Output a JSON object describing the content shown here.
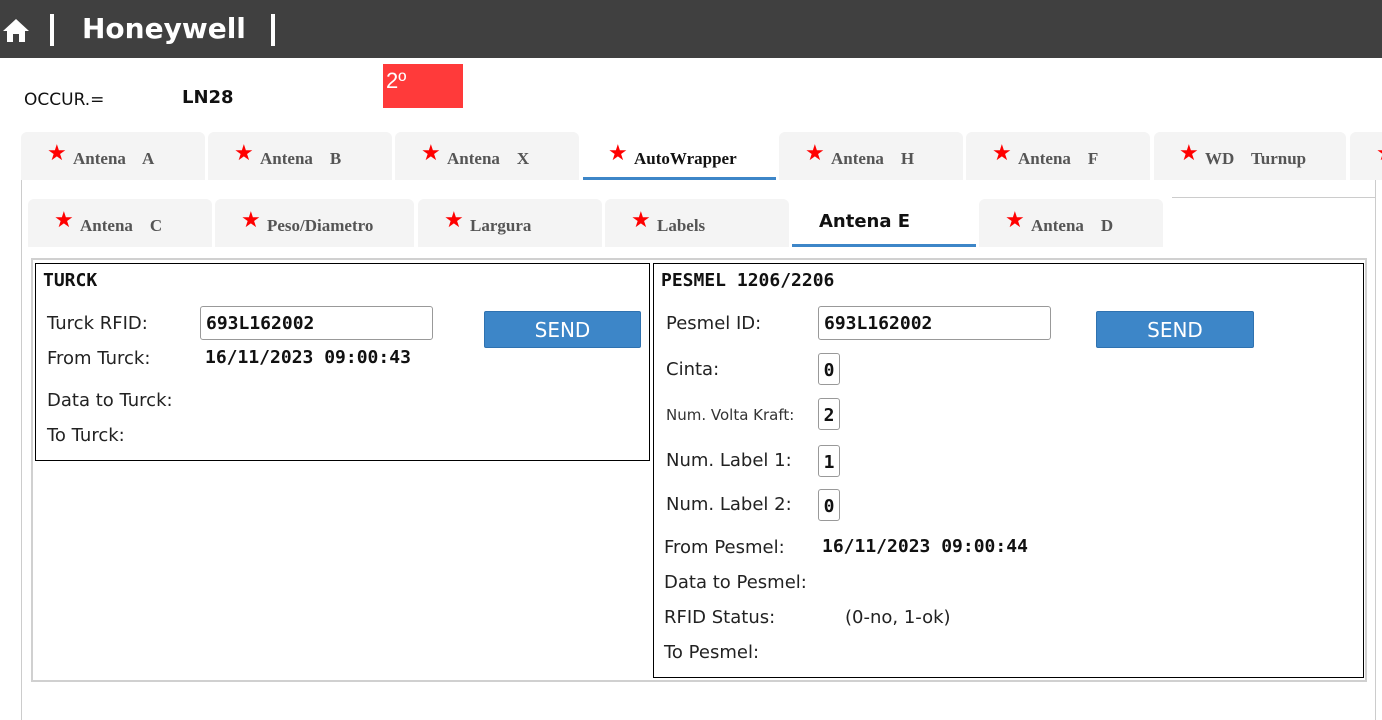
{
  "header": {
    "brand": "Honeywell",
    "home_icon": "home-icon"
  },
  "occur": {
    "label": "OCCUR.=",
    "value": "LN28",
    "badge": "2º",
    "badge_color": "#ff3a3a"
  },
  "tabs_row1": [
    {
      "label": "Antena    A"
    },
    {
      "label": "Antena    B"
    },
    {
      "label": "Antena    X"
    },
    {
      "label": "AutoWrapper"
    },
    {
      "label": "Antena    H"
    },
    {
      "label": "Antena    F"
    },
    {
      "label": "WD    Turnup"
    }
  ],
  "tabs_row2": [
    {
      "label": "Antena    C"
    },
    {
      "label": "Peso/Diametro"
    },
    {
      "label": "Largura"
    },
    {
      "label": "Labels"
    },
    {
      "label": "Antena E"
    },
    {
      "label": "Antena    D"
    }
  ],
  "turck": {
    "title": "TURCK",
    "rfid_label": "Turck RFID:",
    "rfid_value": "693L162002",
    "send_label": "SEND",
    "from_label": "From Turck:",
    "from_value": "16/11/2023 09:00:43",
    "data_to_label": "Data to Turck:",
    "to_label": "To Turck:"
  },
  "pesmel": {
    "title": "PESMEL 1206/2206",
    "id_label": "Pesmel ID:",
    "id_value": "693L162002",
    "send_label": "SEND",
    "cinta_label": "Cinta:",
    "cinta_value": "0",
    "volta_label": "Num. Volta Kraft:",
    "volta_value": "2",
    "label1_label": "Num. Label 1:",
    "label1_value": "1",
    "label2_label": "Num. Label 2:",
    "label2_value": "0",
    "from_label": "From Pesmel:",
    "from_value": "16/11/2023 09:00:44",
    "data_to_label": "Data to Pesmel:",
    "rfid_status_label": "RFID Status:",
    "rfid_status_hint": "(0-no, 1-ok)",
    "to_label": "To Pesmel:"
  },
  "colors": {
    "topbar": "#404040",
    "accent": "#3d86c8",
    "star": "#ff0000"
  }
}
